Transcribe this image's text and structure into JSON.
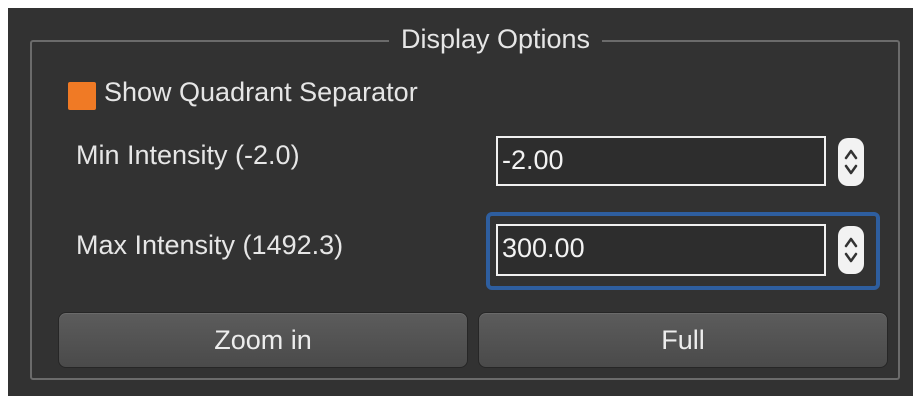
{
  "panel": {
    "title": "Display Options"
  },
  "separator_checkbox": {
    "label": "Show Quadrant Separator",
    "checked": true,
    "color": "#f07a25"
  },
  "min_intensity": {
    "label": "Min Intensity (-2.0)",
    "value": "-2.00"
  },
  "max_intensity": {
    "label": "Max Intensity (1492.3)",
    "value": "300.00",
    "focused": true,
    "focus_color": "#2e5e9f"
  },
  "buttons": {
    "zoom_in": "Zoom in",
    "full": "Full"
  }
}
